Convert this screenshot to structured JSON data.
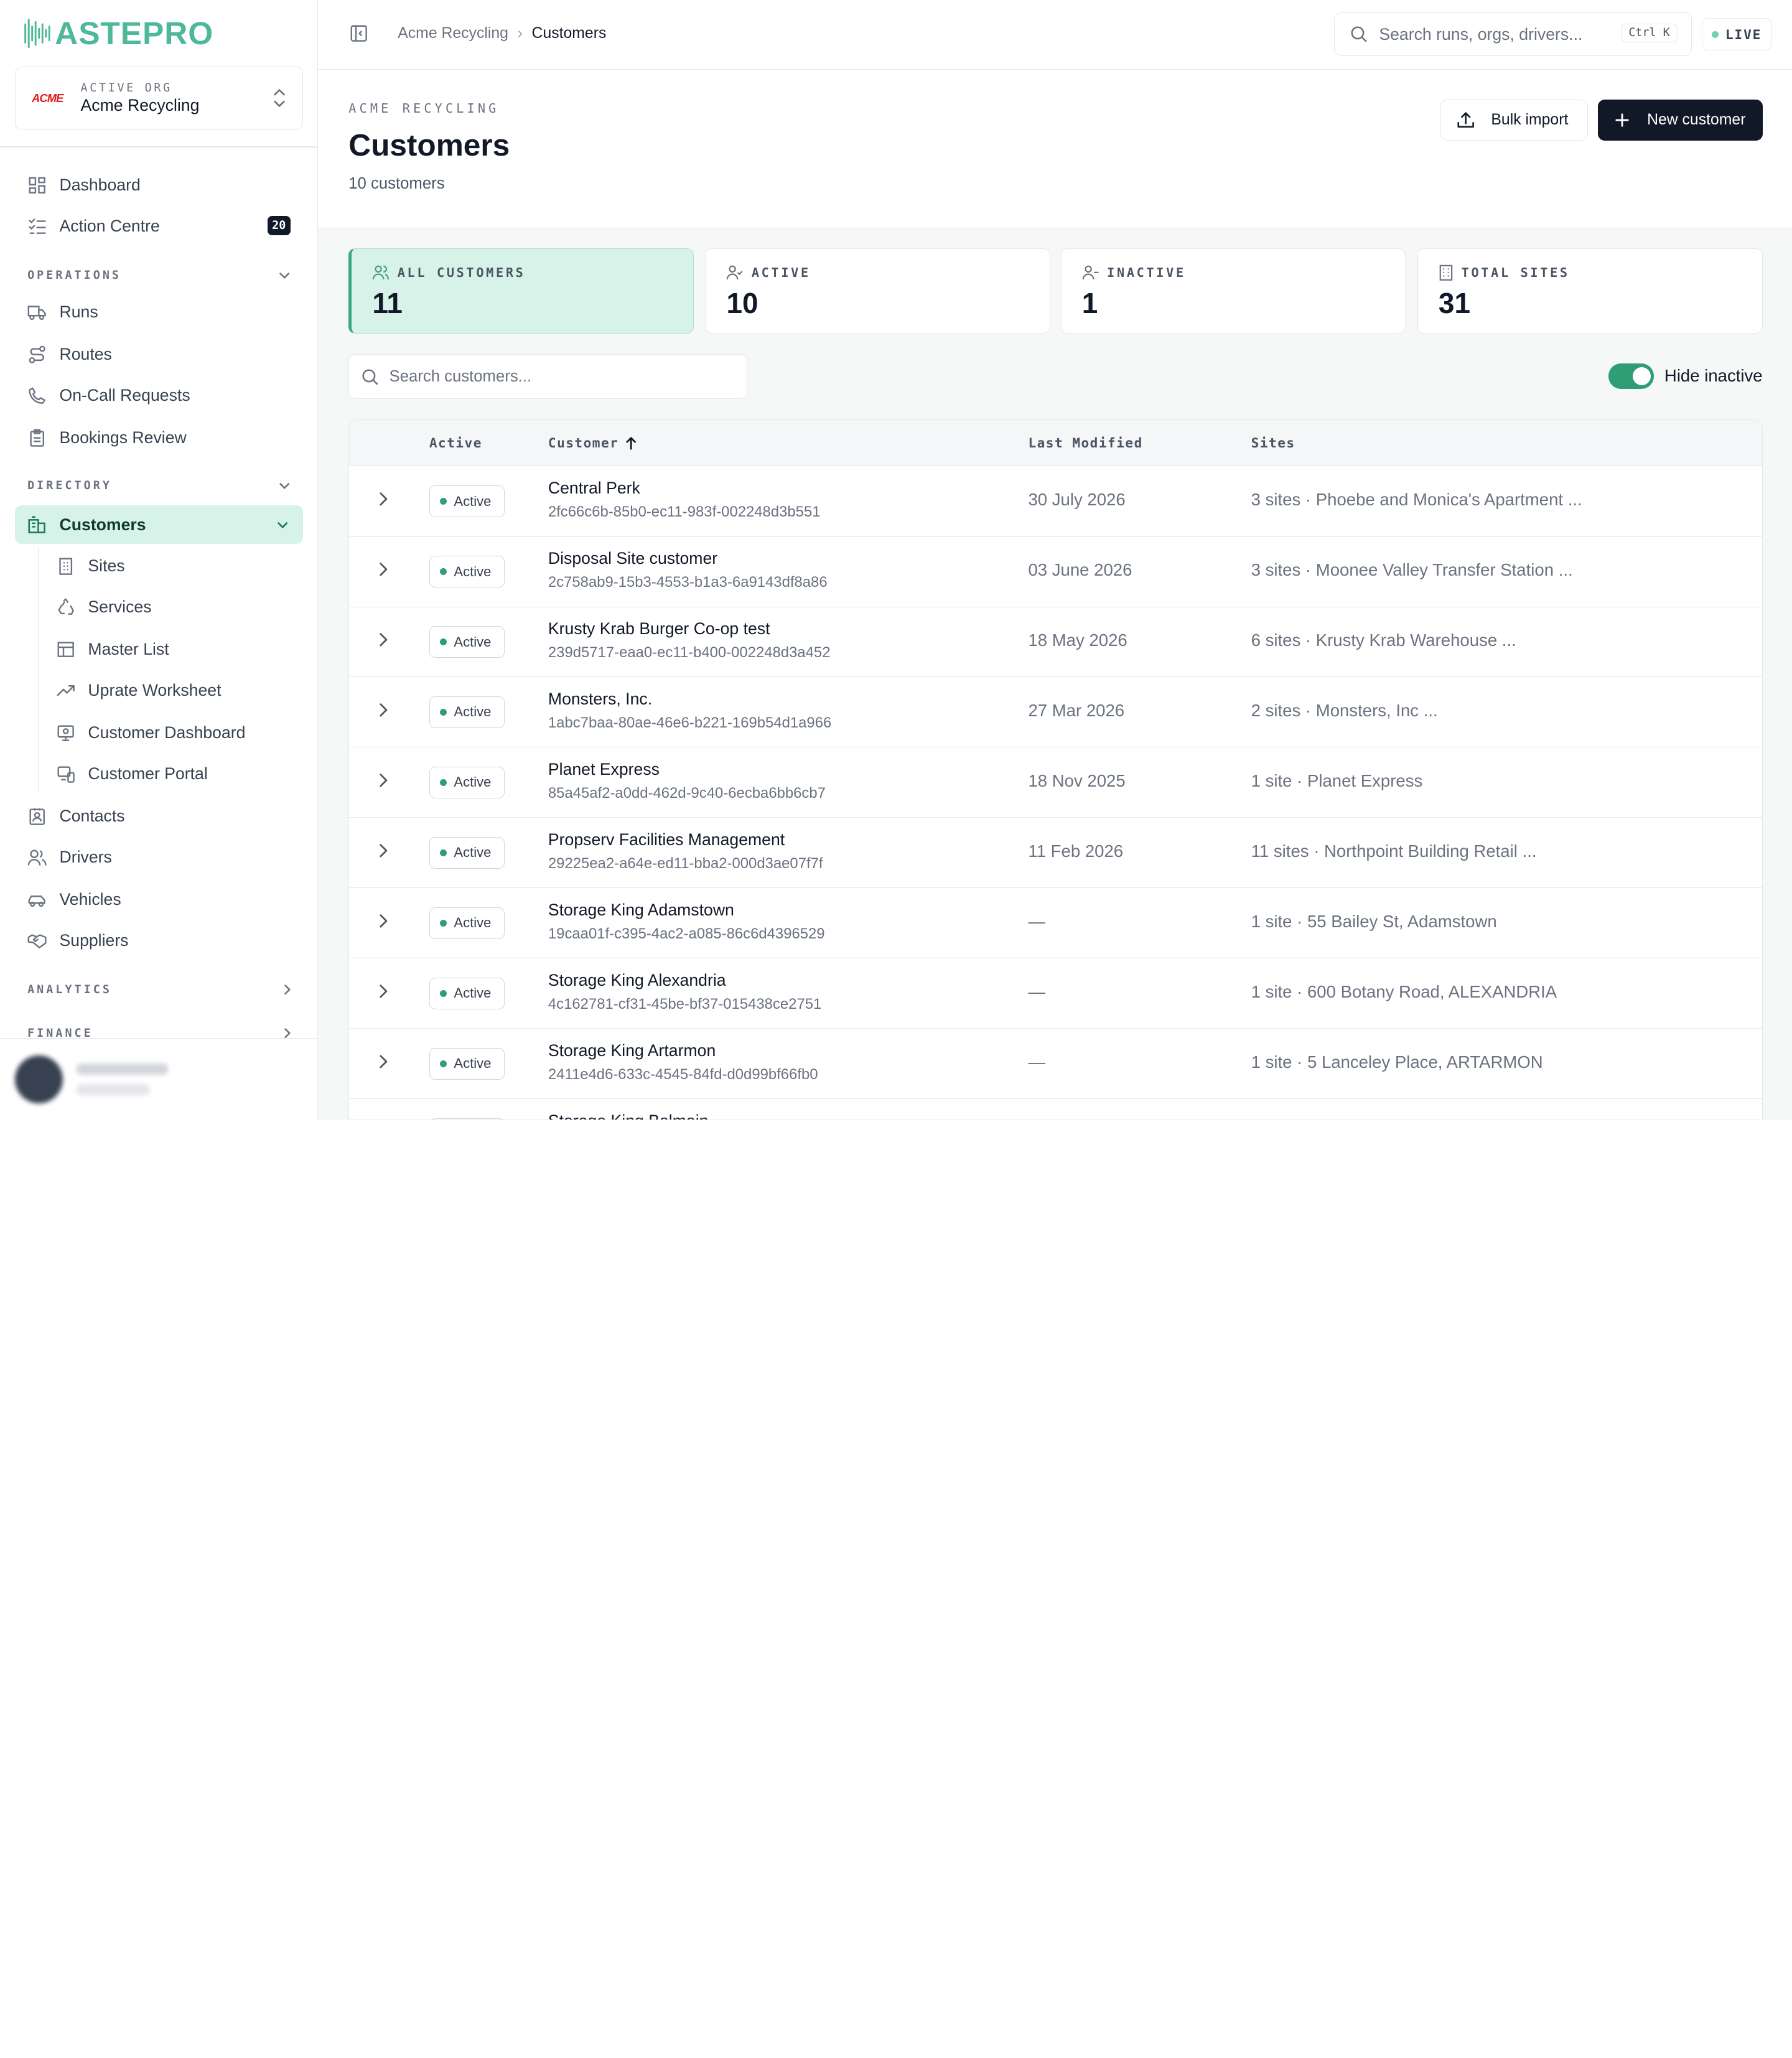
{
  "brand": {
    "name": "ASTEPRO",
    "accent": "#4fb89b"
  },
  "org": {
    "label": "ACTIVE ORG",
    "name": "Acme Recycling",
    "logo_text": "ACME"
  },
  "nav": {
    "top": [
      {
        "label": "Dashboard",
        "icon": "dashboard-icon"
      },
      {
        "label": "Action Centre",
        "icon": "checklist-icon",
        "badge": "20"
      }
    ],
    "operations_label": "OPERATIONS",
    "operations": [
      "Runs",
      "Routes",
      "On-Call Requests",
      "Bookings Review"
    ],
    "directory_label": "DIRECTORY",
    "customers": "Customers",
    "customers_sub": [
      "Sites",
      "Services",
      "Master List",
      "Uprate Worksheet",
      "Customer Dashboard",
      "Customer Portal"
    ],
    "directory": [
      "Contacts",
      "Drivers",
      "Vehicles",
      "Suppliers"
    ],
    "analytics_label": "ANALYTICS",
    "finance_label": "FINANCE"
  },
  "topbar": {
    "crumb_org": "Acme Recycling",
    "crumb_page": "Customers",
    "search_placeholder": "Search runs, orgs, drivers...",
    "shortcut": "Ctrl K",
    "live_label": "LIVE"
  },
  "page": {
    "eyebrow": "ACME RECYCLING",
    "title": "Customers",
    "count": "10 customers",
    "bulk_import": "Bulk import",
    "new_customer": "New customer"
  },
  "stats": [
    {
      "label": "ALL CUSTOMERS",
      "value": "11"
    },
    {
      "label": "ACTIVE",
      "value": "10"
    },
    {
      "label": "INACTIVE",
      "value": "1"
    },
    {
      "label": "TOTAL SITES",
      "value": "31"
    }
  ],
  "filters": {
    "search_placeholder": "Search customers...",
    "hide_inactive_label": "Hide inactive",
    "hide_inactive_on": true
  },
  "table": {
    "headers": {
      "active": "Active",
      "customer": "Customer",
      "modified": "Last Modified",
      "sites": "Sites"
    },
    "rows": [
      {
        "status": "Active",
        "name": "Central Perk",
        "id": "2fc66c6b-85b0-ec11-983f-002248d3b551",
        "modified": "30 July 2026",
        "sites": "3 sites · Phoebe and Monica's Apartment ..."
      },
      {
        "status": "Active",
        "name": "Disposal Site customer",
        "id": "2c758ab9-15b3-4553-b1a3-6a9143df8a86",
        "modified": "03 June 2026",
        "sites": "3 sites · Moonee Valley Transfer Station ..."
      },
      {
        "status": "Active",
        "name": "Krusty Krab Burger Co-op test",
        "id": "239d5717-eaa0-ec11-b400-002248d3a452",
        "modified": "18 May 2026",
        "sites": "6 sites · Krusty Krab Warehouse ..."
      },
      {
        "status": "Active",
        "name": "Monsters, Inc.",
        "id": "1abc7baa-80ae-46e6-b221-169b54d1a966",
        "modified": "27 Mar 2026",
        "sites": "2 sites · Monsters, Inc ..."
      },
      {
        "status": "Active",
        "name": "Planet Express",
        "id": "85a45af2-a0dd-462d-9c40-6ecba6bb6cb7",
        "modified": "18 Nov 2025",
        "sites": "1 site · Planet Express"
      },
      {
        "status": "Active",
        "name": "Propserv Facilities Management",
        "id": "29225ea2-a64e-ed11-bba2-000d3ae07f7f",
        "modified": "11 Feb 2026",
        "sites": "11 sites · Northpoint Building Retail ..."
      },
      {
        "status": "Active",
        "name": "Storage King Adamstown",
        "id": "19caa01f-c395-4ac2-a085-86c6d4396529",
        "modified": "—",
        "sites": "1 site · 55 Bailey St, Adamstown"
      },
      {
        "status": "Active",
        "name": "Storage King Alexandria",
        "id": "4c162781-cf31-45be-bf37-015438ce2751",
        "modified": "—",
        "sites": "1 site · 600 Botany Road, ALEXANDRIA"
      },
      {
        "status": "Active",
        "name": "Storage King Artarmon",
        "id": "2411e4d6-633c-4545-84fd-d0d99bf66fb0",
        "modified": "—",
        "sites": "1 site · 5 Lanceley Place, ARTARMON"
      },
      {
        "status": "Active",
        "name": "Storage King Balmain",
        "id": "",
        "modified": "",
        "sites": ""
      }
    ]
  }
}
